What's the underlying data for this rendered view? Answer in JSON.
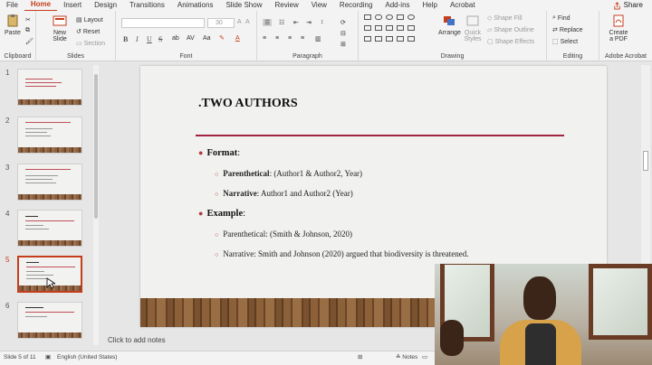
{
  "menu": {
    "tabs": [
      "File",
      "Home",
      "Insert",
      "Design",
      "Transitions",
      "Animations",
      "Slide Show",
      "Review",
      "View",
      "Recording",
      "Add-ins",
      "Help",
      "Acrobat"
    ],
    "active": "Home",
    "share": "Share"
  },
  "ribbon": {
    "clipboard": {
      "paste": "Paste",
      "label": "Clipboard"
    },
    "slides": {
      "new_slide": "New Slide",
      "layout": "Layout",
      "reset": "Reset",
      "section": "Section",
      "label": "Slides"
    },
    "font": {
      "size": "30",
      "bold": "B",
      "italic": "I",
      "underline": "U",
      "strike": "S",
      "label": "Font"
    },
    "paragraph": {
      "label": "Paragraph"
    },
    "drawing": {
      "arrange": "Arrange",
      "quick_styles": "Quick Styles",
      "shape_fill": "Shape Fill",
      "shape_outline": "Shape Outline",
      "shape_effects": "Shape Effects",
      "label": "Drawing"
    },
    "editing": {
      "find": "Find",
      "replace": "Replace",
      "select": "Select",
      "label": "Editing"
    },
    "acrobat": {
      "create_pdf": "Create a PDF",
      "label": "Adobe Acrobat"
    }
  },
  "thumbnails": [
    {
      "number": "1",
      "selected": false
    },
    {
      "number": "2",
      "selected": false
    },
    {
      "number": "3",
      "selected": false
    },
    {
      "number": "4",
      "selected": false
    },
    {
      "number": "5",
      "selected": true
    },
    {
      "number": "6",
      "selected": false
    }
  ],
  "slide": {
    "title": ".TWO AUTHORS",
    "format_label": "Format",
    "format_colon": ":",
    "parenthetical_label": "Parenthetical",
    "parenthetical_text": ": (Author1 & Author2, Year)",
    "narrative_label": "Narrative",
    "narrative_text": ": Author1 and Author2 (Year)",
    "example_label": "Example",
    "example_colon": ":",
    "example_parenthetical": "Parenthetical: (Smith & Johnson, 2020)",
    "example_narrative": "Narrative: Smith and Johnson (2020) argued that biodiversity is threatened."
  },
  "notes_placeholder": "Click to add notes",
  "status": {
    "slide_of": "Slide 5 of 11",
    "language": "English (United States)",
    "notes": "Notes"
  },
  "colors": {
    "accent": "#c43e1c",
    "rule": "#a3243f",
    "bullet": "#b23a3a"
  }
}
